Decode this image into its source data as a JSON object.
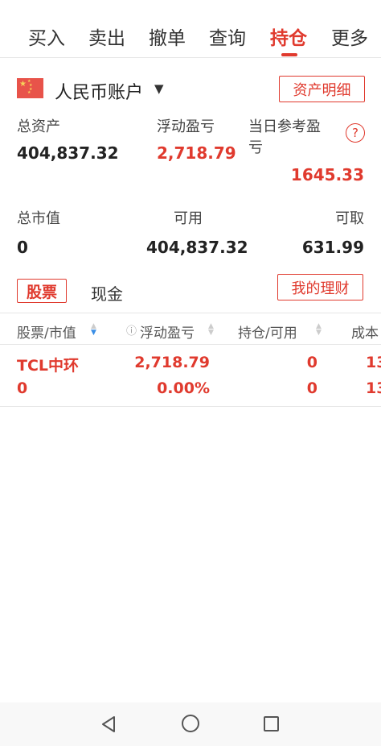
{
  "tabs": [
    {
      "label": "买入"
    },
    {
      "label": "卖出"
    },
    {
      "label": "撤单"
    },
    {
      "label": "查询"
    },
    {
      "label": "持仓",
      "active": true
    },
    {
      "label": "更多"
    }
  ],
  "account": {
    "name": "人民币账户",
    "caret": "▼",
    "detail_button": "资产明细",
    "flag_icon": "china-flag-icon"
  },
  "summary": {
    "total_assets_label": "总资产",
    "total_assets": "404,837.32",
    "floating_pl_label": "浮动盈亏",
    "floating_pl": "2,718.79",
    "today_pl_label_line1": "当日参考盈",
    "today_pl_label_line2": "亏",
    "today_pl": "1645.33",
    "help_icon": "?",
    "market_value_label": "总市值",
    "market_value": "0",
    "available_label": "可用",
    "available": "404,837.32",
    "withdrawable_label": "可取",
    "withdrawable": "631.99"
  },
  "holdings_tabs": {
    "stock": "股票",
    "cash": "现金",
    "finance_button": "我的理财"
  },
  "table": {
    "headers": [
      "股票/市值",
      "浮动盈亏",
      "持仓/可用",
      "成本"
    ],
    "rows": [
      {
        "name": "TCL中环",
        "market_value": "0",
        "pl": "2,718.79",
        "pl_pct": "0.00%",
        "position": "0",
        "available": "0",
        "cost_1": "13",
        "cost_2": "13"
      }
    ]
  },
  "colors": {
    "accent": "#e03a2e",
    "sort_active": "#3a8ee6"
  }
}
